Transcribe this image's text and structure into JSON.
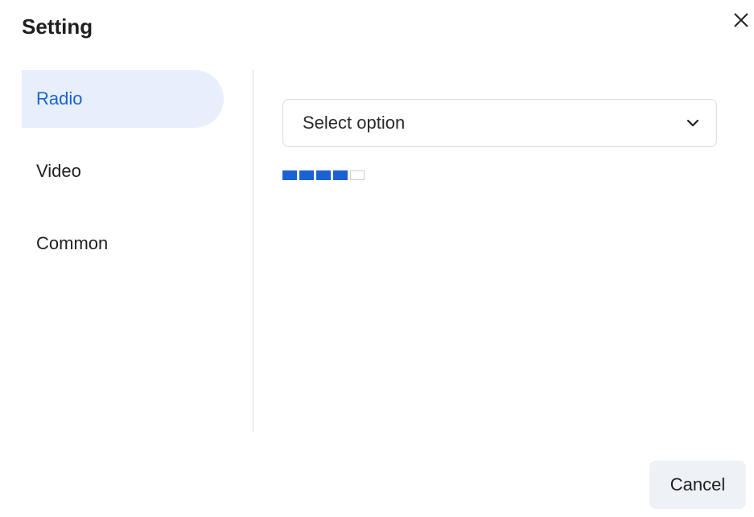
{
  "dialog": {
    "title": "Setting",
    "close_icon": "close-icon"
  },
  "sidebar": {
    "items": [
      {
        "label": "Radio",
        "active": true
      },
      {
        "label": "Video",
        "active": false
      },
      {
        "label": "Common",
        "active": false
      }
    ]
  },
  "main": {
    "select": {
      "placeholder": "Select option",
      "icon": "chevron-down-icon"
    },
    "level_meter": {
      "total_segments": 5,
      "filled_segments": 4
    }
  },
  "footer": {
    "cancel_label": "Cancel"
  },
  "colors": {
    "accent": "#1a62d2",
    "active_bg": "#e8effc",
    "button_bg": "#eef1f5"
  }
}
